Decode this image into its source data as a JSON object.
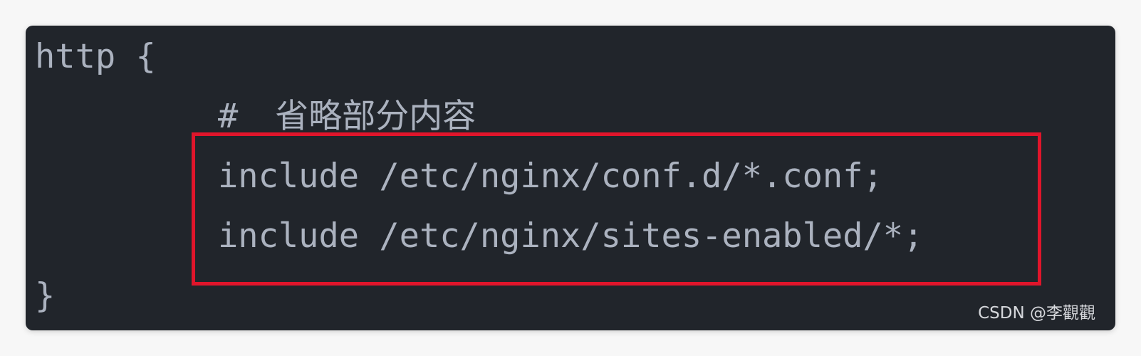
{
  "code": {
    "lines": [
      "http {",
      "#",
      "include /etc/nginx/conf.d/*.conf;",
      "include /etc/nginx/sites-enabled/*;",
      "}"
    ],
    "comment_text": "省略部分内容"
  },
  "highlight": {
    "color": "#e0152b"
  },
  "watermark": {
    "text": "CSDN @李觀觀"
  },
  "theme": {
    "background": "#21252b",
    "foreground": "#abb2bf"
  }
}
